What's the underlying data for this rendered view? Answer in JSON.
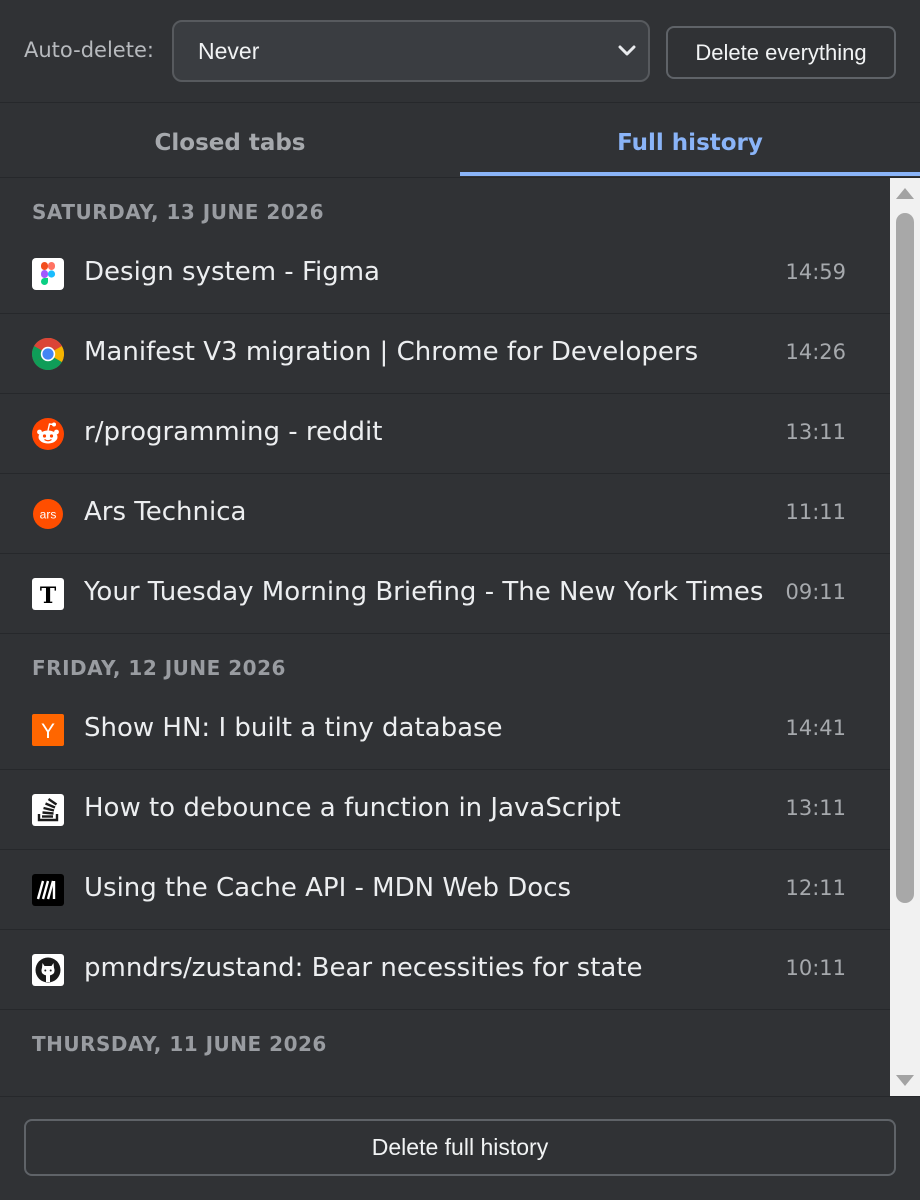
{
  "header": {
    "auto_delete_label": "Auto-delete:",
    "auto_delete_value": "Never",
    "delete_everything_label": "Delete everything"
  },
  "tabs": [
    {
      "label": "Closed tabs",
      "active": false
    },
    {
      "label": "Full history",
      "active": true
    }
  ],
  "history": [
    {
      "date": "SATURDAY, 13 JUNE 2026",
      "items": [
        {
          "title": "Design system - Figma",
          "time": "14:59",
          "icon": "figma-icon"
        },
        {
          "title": "Manifest V3 migration | Chrome for Developers",
          "time": "14:26",
          "icon": "chrome-icon"
        },
        {
          "title": "r/programming - reddit",
          "time": "13:11",
          "icon": "reddit-icon"
        },
        {
          "title": "Ars Technica",
          "time": "11:11",
          "icon": "ars-technica-icon"
        },
        {
          "title": "Your Tuesday Morning Briefing - The New York Times",
          "time": "09:11",
          "icon": "nytimes-icon"
        }
      ]
    },
    {
      "date": "FRIDAY, 12 JUNE 2026",
      "items": [
        {
          "title": "Show HN: I built a tiny database",
          "time": "14:41",
          "icon": "hacker-news-icon"
        },
        {
          "title": "How to debounce a function in JavaScript",
          "time": "13:11",
          "icon": "stack-overflow-icon"
        },
        {
          "title": "Using the Cache API - MDN Web Docs",
          "time": "12:11",
          "icon": "mdn-icon"
        },
        {
          "title": "pmndrs/zustand: Bear necessities for state",
          "time": "10:11",
          "icon": "github-icon"
        }
      ]
    },
    {
      "date": "THURSDAY, 11 JUNE 2026",
      "items": []
    }
  ],
  "footer": {
    "delete_full_history_label": "Delete full history"
  },
  "colors": {
    "background": "#303235",
    "accent": "#8ab4f8"
  }
}
